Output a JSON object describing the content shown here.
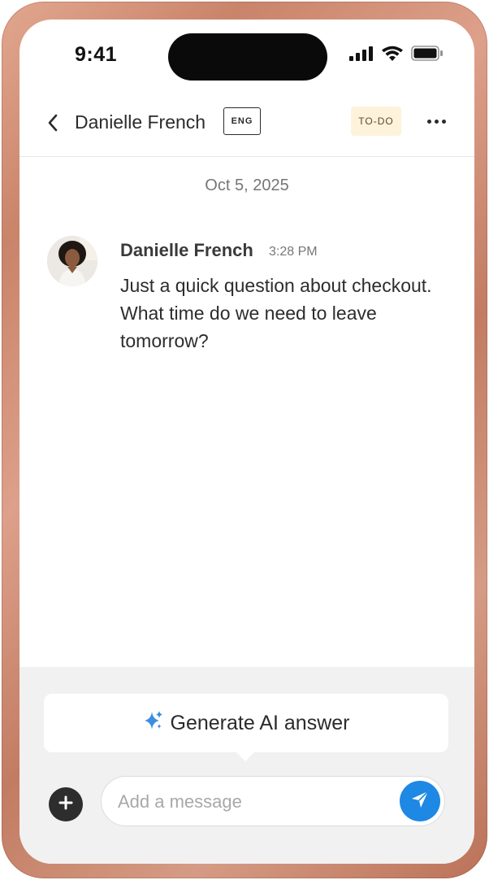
{
  "status_bar": {
    "time": "9:41",
    "icons": [
      "cellular-signal-icon",
      "wifi-icon",
      "battery-icon"
    ]
  },
  "header": {
    "back_icon": "chevron-left-icon",
    "contact_name": "Danielle French",
    "language_badge": "ENG",
    "status_badge": "TO-DO",
    "more_icon": "more-horizontal-icon"
  },
  "conversation": {
    "date_divider": "Oct 5, 2025",
    "messages": [
      {
        "sender": "Danielle French",
        "time": "3:28 PM",
        "text": "Just a quick question about checkout. What time do we need to leave tomorrow?"
      }
    ]
  },
  "composer": {
    "ai_button_label": "Generate AI answer",
    "ai_icon": "sparkle-icon",
    "add_icon": "plus-icon",
    "input_value": "",
    "input_placeholder": "Add a message",
    "send_icon": "send-icon"
  },
  "colors": {
    "frame": "#c9846a",
    "accent": "#1e88e5",
    "todo_badge_bg": "#fdf3da",
    "composer_bg": "#f1f1f1"
  }
}
